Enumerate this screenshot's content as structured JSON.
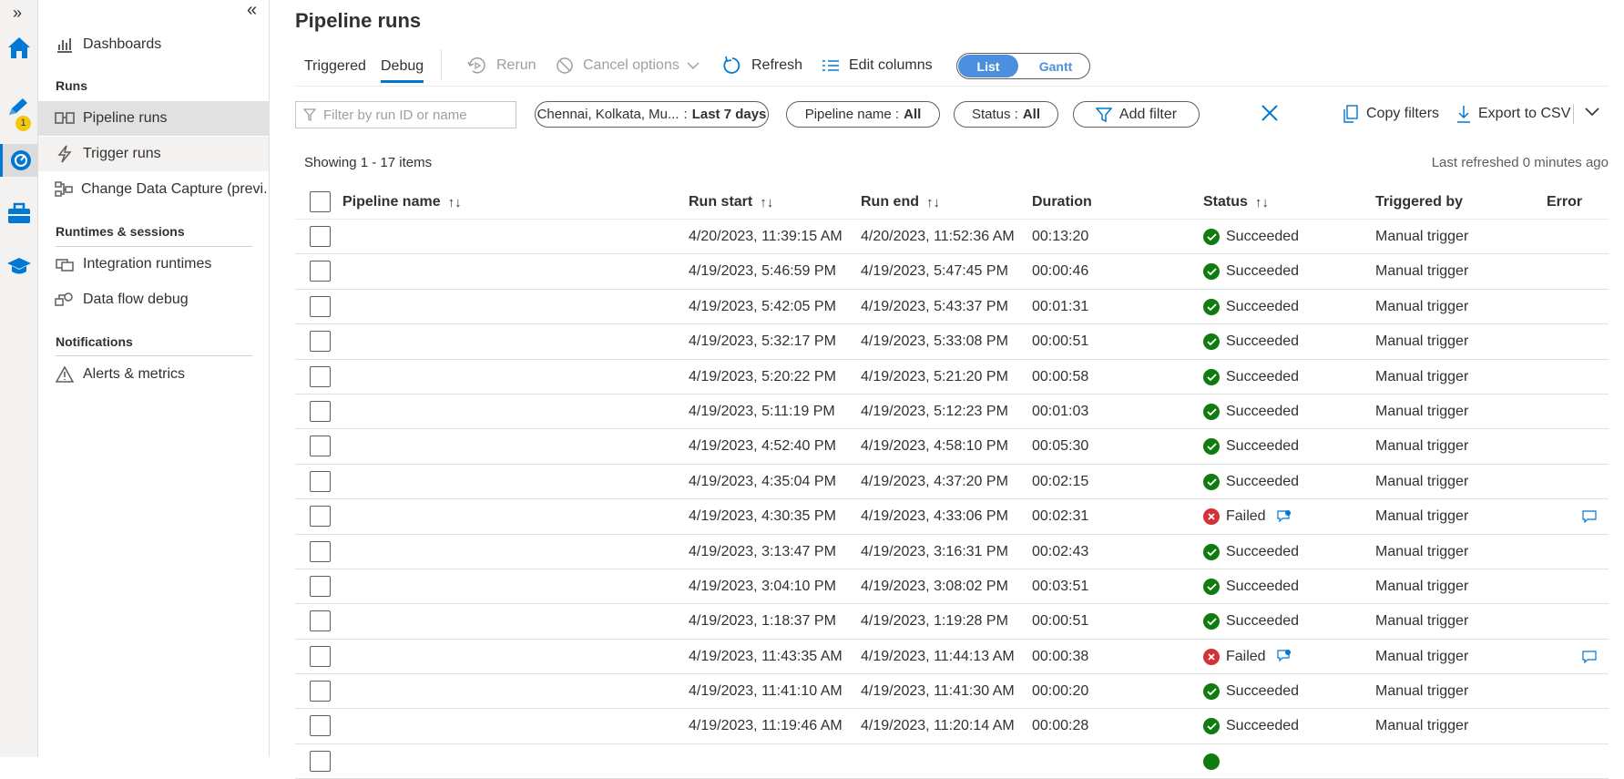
{
  "page": {
    "title": "Pipeline runs"
  },
  "sidebar": {
    "dashboards": "Dashboards",
    "section_runs": "Runs",
    "pipeline_runs": "Pipeline runs",
    "trigger_runs": "Trigger runs",
    "change_data_capture": "Change Data Capture (previ...",
    "section_runtimes": "Runtimes & sessions",
    "integration_runtimes": "Integration runtimes",
    "data_flow_debug": "Data flow debug",
    "section_notifications": "Notifications",
    "alerts_metrics": "Alerts & metrics",
    "author_badge": "1"
  },
  "toolbar": {
    "tab_triggered": "Triggered",
    "tab_debug": "Debug",
    "rerun": "Rerun",
    "cancel_options": "Cancel options",
    "refresh": "Refresh",
    "edit_columns": "Edit columns",
    "view_list": "List",
    "view_gantt": "Gantt"
  },
  "filters": {
    "search_placeholder": "Filter by run ID or name",
    "region_label": "Chennai, Kolkata, Mu...",
    "region_value": "Last 7 days",
    "pipeline_label": "Pipeline name :",
    "pipeline_value": "All",
    "status_label": "Status :",
    "status_value": "All",
    "add_filter": "Add filter",
    "copy_filters": "Copy filters",
    "export_csv": "Export to CSV"
  },
  "summary": {
    "showing": "Showing 1 - 17 items",
    "last_refreshed": "Last refreshed 0 minutes ago"
  },
  "table": {
    "columns": {
      "pipeline_name": "Pipeline name",
      "run_start": "Run start",
      "run_end": "Run end",
      "duration": "Duration",
      "status": "Status",
      "triggered_by": "Triggered by",
      "error": "Error"
    },
    "rows": [
      {
        "start": "4/20/2023, 11:39:15 AM",
        "end": "4/20/2023, 11:52:36 AM",
        "duration": "00:13:20",
        "status": "Succeeded",
        "triggered_by": "Manual trigger"
      },
      {
        "start": "4/19/2023, 5:46:59 PM",
        "end": "4/19/2023, 5:47:45 PM",
        "duration": "00:00:46",
        "status": "Succeeded",
        "triggered_by": "Manual trigger"
      },
      {
        "start": "4/19/2023, 5:42:05 PM",
        "end": "4/19/2023, 5:43:37 PM",
        "duration": "00:01:31",
        "status": "Succeeded",
        "triggered_by": "Manual trigger"
      },
      {
        "start": "4/19/2023, 5:32:17 PM",
        "end": "4/19/2023, 5:33:08 PM",
        "duration": "00:00:51",
        "status": "Succeeded",
        "triggered_by": "Manual trigger"
      },
      {
        "start": "4/19/2023, 5:20:22 PM",
        "end": "4/19/2023, 5:21:20 PM",
        "duration": "00:00:58",
        "status": "Succeeded",
        "triggered_by": "Manual trigger"
      },
      {
        "start": "4/19/2023, 5:11:19 PM",
        "end": "4/19/2023, 5:12:23 PM",
        "duration": "00:01:03",
        "status": "Succeeded",
        "triggered_by": "Manual trigger"
      },
      {
        "start": "4/19/2023, 4:52:40 PM",
        "end": "4/19/2023, 4:58:10 PM",
        "duration": "00:05:30",
        "status": "Succeeded",
        "triggered_by": "Manual trigger"
      },
      {
        "start": "4/19/2023, 4:35:04 PM",
        "end": "4/19/2023, 4:37:20 PM",
        "duration": "00:02:15",
        "status": "Succeeded",
        "triggered_by": "Manual trigger"
      },
      {
        "start": "4/19/2023, 4:30:35 PM",
        "end": "4/19/2023, 4:33:06 PM",
        "duration": "00:02:31",
        "status": "Failed",
        "triggered_by": "Manual trigger"
      },
      {
        "start": "4/19/2023, 3:13:47 PM",
        "end": "4/19/2023, 3:16:31 PM",
        "duration": "00:02:43",
        "status": "Succeeded",
        "triggered_by": "Manual trigger"
      },
      {
        "start": "4/19/2023, 3:04:10 PM",
        "end": "4/19/2023, 3:08:02 PM",
        "duration": "00:03:51",
        "status": "Succeeded",
        "triggered_by": "Manual trigger"
      },
      {
        "start": "4/19/2023, 1:18:37 PM",
        "end": "4/19/2023, 1:19:28 PM",
        "duration": "00:00:51",
        "status": "Succeeded",
        "triggered_by": "Manual trigger"
      },
      {
        "start": "4/19/2023, 11:43:35 AM",
        "end": "4/19/2023, 11:44:13 AM",
        "duration": "00:00:38",
        "status": "Failed",
        "triggered_by": "Manual trigger"
      },
      {
        "start": "4/19/2023, 11:41:10 AM",
        "end": "4/19/2023, 11:41:30 AM",
        "duration": "00:00:20",
        "status": "Succeeded",
        "triggered_by": "Manual trigger"
      },
      {
        "start": "4/19/2023, 11:19:46 AM",
        "end": "4/19/2023, 11:20:14 AM",
        "duration": "00:00:28",
        "status": "Succeeded",
        "triggered_by": "Manual trigger"
      }
    ]
  },
  "colors": {
    "accent": "#0078d4",
    "success": "#107c10",
    "failure": "#d13438",
    "toggle": "#4c8fde"
  },
  "icons": [
    "home-icon",
    "pencil-icon",
    "monitor-icon",
    "toolbox-icon",
    "learn-icon",
    "dashboard-icon",
    "pipeline-icon",
    "trigger-icon",
    "cdc-icon",
    "integration-runtime-icon",
    "dataflow-debug-icon",
    "alert-icon",
    "rerun-icon",
    "cancel-icon",
    "refresh-icon",
    "edit-columns-icon",
    "filter-icon",
    "close-icon",
    "copy-icon",
    "download-icon",
    "chevron-down-icon",
    "check-circle-icon",
    "error-circle-icon",
    "comment-icon"
  ]
}
